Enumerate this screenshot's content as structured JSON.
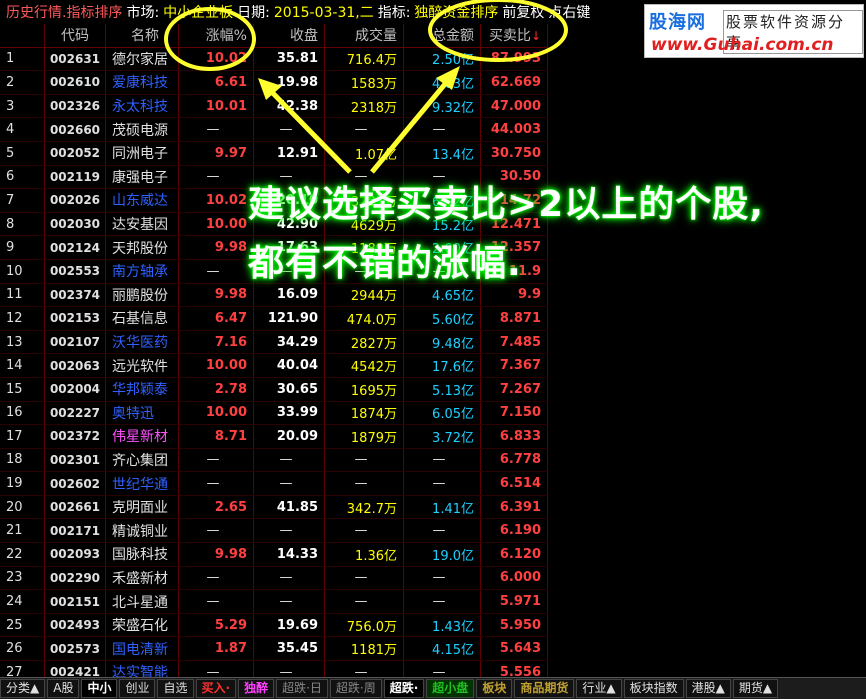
{
  "header": {
    "title": "历史行情.指标排序",
    "market_label": "市场:",
    "market_value": "中小企业板",
    "date_label": "日期:",
    "date_value": "2015-03-31,二",
    "indicator_label": "指标:",
    "indicator_value": "独醉资金排序",
    "adjust": "前复权",
    "more": "点右键"
  },
  "logo": {
    "brand": "股海网",
    "tagline": "股票软件资源分享",
    "url": "www.Guhai.com.cn"
  },
  "columns": {
    "idx": "",
    "code": "代码",
    "name": "名称",
    "pct": "涨幅%",
    "cap": "收盘",
    "vol": "成交量",
    "amt": "总金额",
    "ratio": "买卖比",
    "sort_arrow": "↓"
  },
  "rows": [
    {
      "idx": "1",
      "code": "002631",
      "name": "德尔家居",
      "nc": "n-white",
      "pct": "10.02",
      "cap": "35.81",
      "vol": "716.4万",
      "amt": "2.50亿",
      "ratio": "87.993"
    },
    {
      "idx": "2",
      "code": "002610",
      "name": "爱康科技",
      "nc": "n-blue",
      "pct": "6.61",
      "cap": "19.98",
      "vol": "1583万",
      "amt": "4.63亿",
      "ratio": "62.669"
    },
    {
      "idx": "3",
      "code": "002326",
      "name": "永太科技",
      "nc": "n-blue",
      "pct": "10.01",
      "cap": "42.38",
      "vol": "2318万",
      "amt": "9.32亿",
      "ratio": "47.000"
    },
    {
      "idx": "4",
      "code": "002660",
      "name": "茂硕电源",
      "nc": "n-white",
      "pct": "—",
      "cap": "—",
      "vol": "—",
      "amt": "—",
      "ratio": "44.003"
    },
    {
      "idx": "5",
      "code": "002052",
      "name": "同洲电子",
      "nc": "n-white",
      "pct": "9.97",
      "cap": "12.91",
      "vol": "1.07亿",
      "amt": "13.4亿",
      "ratio": "30.750"
    },
    {
      "idx": "6",
      "code": "002119",
      "name": "康强电子",
      "nc": "n-white",
      "pct": "—",
      "cap": "—",
      "vol": "—",
      "amt": "—",
      "ratio": "30.50"
    },
    {
      "idx": "7",
      "code": "002026",
      "name": "山东威达",
      "nc": "n-blue",
      "pct": "10.02",
      "cap": "20.10",
      "vol": "3281万",
      "amt": "6.42亿",
      "ratio": "14.72"
    },
    {
      "idx": "8",
      "code": "002030",
      "name": "达安基因",
      "nc": "n-white",
      "pct": "10.00",
      "cap": "42.90",
      "vol": "4629万",
      "amt": "15.2亿",
      "ratio": "12.471"
    },
    {
      "idx": "9",
      "code": "002124",
      "name": "天邦股份",
      "nc": "n-white",
      "pct": "9.98",
      "cap": "17.63",
      "vol": "1189万",
      "amt": "2.00亿",
      "ratio": "12.357"
    },
    {
      "idx": "10",
      "code": "002553",
      "name": "南方轴承",
      "nc": "n-blue",
      "pct": "—",
      "cap": "—",
      "vol": "—",
      "amt": "—",
      "ratio": "11.9"
    },
    {
      "idx": "11",
      "code": "002374",
      "name": "丽鹏股份",
      "nc": "n-white",
      "pct": "9.98",
      "cap": "16.09",
      "vol": "2944万",
      "amt": "4.65亿",
      "ratio": "9.9"
    },
    {
      "idx": "12",
      "code": "002153",
      "name": "石基信息",
      "nc": "n-white",
      "pct": "6.47",
      "cap": "121.90",
      "vol": "474.0万",
      "amt": "5.60亿",
      "ratio": "8.871"
    },
    {
      "idx": "13",
      "code": "002107",
      "name": "沃华医药",
      "nc": "n-blue",
      "pct": "7.16",
      "cap": "34.29",
      "vol": "2827万",
      "amt": "9.48亿",
      "ratio": "7.485"
    },
    {
      "idx": "14",
      "code": "002063",
      "name": "远光软件",
      "nc": "n-white",
      "pct": "10.00",
      "cap": "40.04",
      "vol": "4542万",
      "amt": "17.6亿",
      "ratio": "7.367"
    },
    {
      "idx": "15",
      "code": "002004",
      "name": "华邦颖泰",
      "nc": "n-blue",
      "pct": "2.78",
      "cap": "30.65",
      "vol": "1695万",
      "amt": "5.13亿",
      "ratio": "7.267"
    },
    {
      "idx": "16",
      "code": "002227",
      "name": "奥特迅",
      "nc": "n-blue",
      "pct": "10.00",
      "cap": "33.99",
      "vol": "1874万",
      "amt": "6.05亿",
      "ratio": "7.150"
    },
    {
      "idx": "17",
      "code": "002372",
      "name": "伟星新材",
      "nc": "n-pink",
      "pct": "8.71",
      "cap": "20.09",
      "vol": "1879万",
      "amt": "3.72亿",
      "ratio": "6.833"
    },
    {
      "idx": "18",
      "code": "002301",
      "name": "齐心集团",
      "nc": "n-white",
      "pct": "—",
      "cap": "—",
      "vol": "—",
      "amt": "—",
      "ratio": "6.778"
    },
    {
      "idx": "19",
      "code": "002602",
      "name": "世纪华通",
      "nc": "n-blue",
      "pct": "—",
      "cap": "—",
      "vol": "—",
      "amt": "—",
      "ratio": "6.514"
    },
    {
      "idx": "20",
      "code": "002661",
      "name": "克明面业",
      "nc": "n-white",
      "pct": "2.65",
      "cap": "41.85",
      "vol": "342.7万",
      "amt": "1.41亿",
      "ratio": "6.391"
    },
    {
      "idx": "21",
      "code": "002171",
      "name": "精诚铜业",
      "nc": "n-white",
      "pct": "—",
      "cap": "—",
      "vol": "—",
      "amt": "—",
      "ratio": "6.190"
    },
    {
      "idx": "22",
      "code": "002093",
      "name": "国脉科技",
      "nc": "n-white",
      "pct": "9.98",
      "cap": "14.33",
      "vol": "1.36亿",
      "amt": "19.0亿",
      "ratio": "6.120"
    },
    {
      "idx": "23",
      "code": "002290",
      "name": "禾盛新材",
      "nc": "n-white",
      "pct": "—",
      "cap": "—",
      "vol": "—",
      "amt": "—",
      "ratio": "6.000"
    },
    {
      "idx": "24",
      "code": "002151",
      "name": "北斗星通",
      "nc": "n-white",
      "pct": "—",
      "cap": "—",
      "vol": "—",
      "amt": "—",
      "ratio": "5.971"
    },
    {
      "idx": "25",
      "code": "002493",
      "name": "荣盛石化",
      "nc": "n-white",
      "pct": "5.29",
      "cap": "19.69",
      "vol": "756.0万",
      "amt": "1.43亿",
      "ratio": "5.950"
    },
    {
      "idx": "26",
      "code": "002573",
      "name": "国电清新",
      "nc": "n-blue",
      "pct": "1.87",
      "cap": "35.45",
      "vol": "1181万",
      "amt": "4.15亿",
      "ratio": "5.643"
    },
    {
      "idx": "27",
      "code": "002421",
      "name": "达实智能",
      "nc": "n-blue",
      "pct": "—",
      "cap": "—",
      "vol": "—",
      "amt": "—",
      "ratio": "5.556"
    }
  ],
  "tabs": [
    {
      "label": "分类▲",
      "cls": ""
    },
    {
      "label": "A股",
      "cls": ""
    },
    {
      "label": "中小",
      "cls": "active"
    },
    {
      "label": "创业",
      "cls": ""
    },
    {
      "label": "自选",
      "cls": ""
    },
    {
      "label": "买入·",
      "cls": "red"
    },
    {
      "label": "独醉",
      "cls": "mag"
    },
    {
      "label": "超跌·日",
      "cls": "gray"
    },
    {
      "label": "超跌·周",
      "cls": "gray"
    },
    {
      "label": "超跌·",
      "cls": "active"
    },
    {
      "label": "超小盘",
      "cls": "green"
    },
    {
      "label": "板块",
      "cls": "olive"
    },
    {
      "label": "商品期货",
      "cls": "olive"
    },
    {
      "label": "行业▲",
      "cls": ""
    },
    {
      "label": "板块指数",
      "cls": ""
    },
    {
      "label": "港股▲",
      "cls": ""
    },
    {
      "label": "期货▲",
      "cls": ""
    }
  ],
  "annotation": {
    "line1": "建议选择买卖比>2以上的个股,",
    "line2": "都有不错的涨幅."
  }
}
